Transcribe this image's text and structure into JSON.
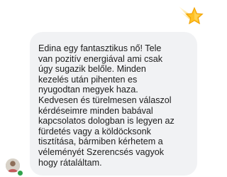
{
  "message": {
    "text": "Edina egy fantasztikus nő! Tele\nvan pozitív energiával ami csak\núgy sugazik belőle. Minden\nkezelés után pihenten es\nnyugodtan megyek haza.\nKedvesen és türelmesen  válaszol\nkérdéseimre minden babával\nkapcsolatos dologban is legyen az\nfürdetés vagy a köldöcksonk\ntisztítása, bármiben kérhetem a\nvéleményét Szerencsés vagyok\nhogy rátaláltam."
  },
  "reaction": {
    "icon": "shooting-star-icon"
  },
  "sender": {
    "avatar": "avatar-icon",
    "status_color": "#31a24c"
  }
}
